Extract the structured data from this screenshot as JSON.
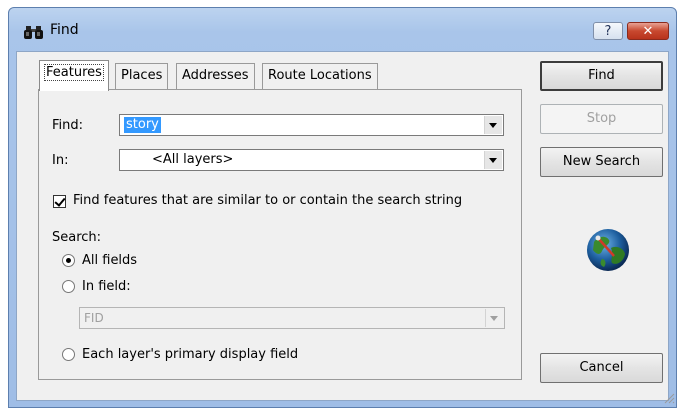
{
  "window": {
    "title": "Find",
    "help_label": "?",
    "close_label": "✕"
  },
  "tabs": [
    {
      "label": "Features",
      "active": true
    },
    {
      "label": "Places"
    },
    {
      "label": "Addresses"
    },
    {
      "label": "Route Locations"
    }
  ],
  "form": {
    "find_label": "Find:",
    "find_value": "story",
    "in_label": "In:",
    "in_value": "<All layers>",
    "similar_checkbox_label": "Find features that are similar to or contain the search string",
    "similar_checked": true,
    "search_label": "Search:",
    "options": [
      {
        "label": "All fields",
        "selected": true
      },
      {
        "label": "In field:",
        "selected": false
      },
      {
        "label": "Each layer's primary display field",
        "selected": false
      }
    ],
    "field_value": "FID"
  },
  "buttons": {
    "find": "Find",
    "stop": "Stop",
    "new_search": "New Search",
    "cancel": "Cancel"
  },
  "colors": {
    "selection": "#3399ff",
    "title_bar": "#a9c5ea",
    "close_button": "#c8482f"
  },
  "icons": [
    "binoculars-icon",
    "globe-icon",
    "resize-grip-icon",
    "dropdown-arrow-icon"
  ]
}
